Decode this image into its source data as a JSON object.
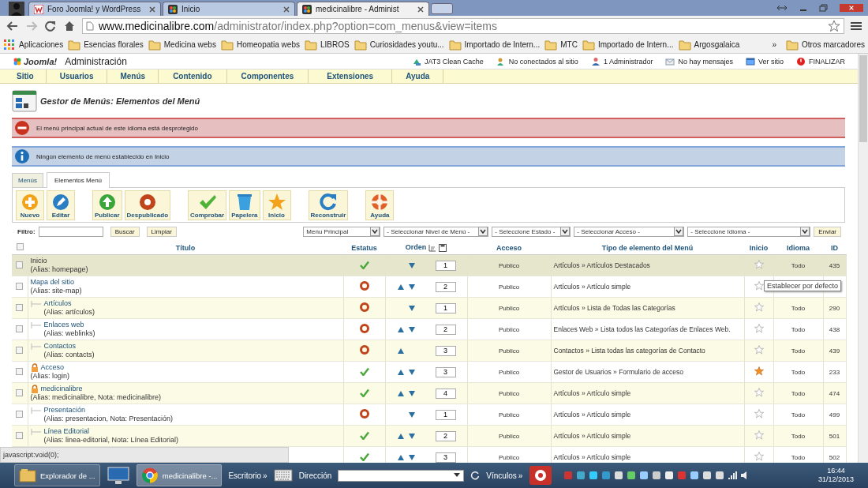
{
  "browser": {
    "tabs": [
      {
        "title": "Foro Joomla! y WordPress",
        "kind": "forum",
        "selected": false
      },
      {
        "title": "Inicio",
        "kind": "joomla",
        "selected": false
      },
      {
        "title": "medicinalibre - Administ",
        "kind": "joomla",
        "selected": true
      }
    ],
    "url_host": "www.medicinalibre.com",
    "url_path": "/administrator/index.php?option=com_menus&view=items",
    "bookmarks": [
      {
        "label": "Aplicaciones",
        "kind": "apps"
      },
      {
        "label": "Esencias florales",
        "kind": "folder"
      },
      {
        "label": "Medicina webs",
        "kind": "folder"
      },
      {
        "label": "Homeopatia webs",
        "kind": "folder"
      },
      {
        "label": "LIBROS",
        "kind": "folder"
      },
      {
        "label": "Curiosidades youtu...",
        "kind": "folder"
      },
      {
        "label": "Importado de Intern...",
        "kind": "folder"
      },
      {
        "label": "MTC",
        "kind": "folder"
      },
      {
        "label": "Importado de Intern...",
        "kind": "folder"
      },
      {
        "label": "Argosgalaica",
        "kind": "folder"
      }
    ],
    "bookmarks_more": "»",
    "other_bookmarks": "Otros marcadores"
  },
  "admin_header": {
    "logo": "Joomla!",
    "title": "Administración",
    "status_items": [
      {
        "label": "JAT3 Clean Cache",
        "kind": "cache"
      },
      {
        "label": "No conectados al sitio",
        "kind": "users"
      },
      {
        "label": "1 Administrador",
        "kind": "admin"
      },
      {
        "label": "No hay mensajes",
        "kind": "messages"
      },
      {
        "label": "Ver sitio",
        "kind": "site"
      },
      {
        "label": "FINALIZAR",
        "kind": "logout"
      }
    ]
  },
  "menu_bar": [
    "Sitio",
    "Usuarios",
    "Menús",
    "Contenido",
    "Componentes",
    "Extensiones",
    "Ayuda"
  ],
  "page_title": "Gestor de Menús: Elementos del Menú",
  "messages": [
    {
      "kind": "error",
      "text": "El menú principal actual de este idioma está desprotegido"
    },
    {
      "kind": "info",
      "text": "Ningún elemento de menú establecido en Inicio"
    }
  ],
  "tabs": [
    {
      "label": "Menús",
      "selected": false
    },
    {
      "label": "Elementos Menú",
      "selected": true
    }
  ],
  "toolbar": [
    [
      {
        "label": "Nuevo",
        "kind": "new"
      },
      {
        "label": "Editar",
        "kind": "edit"
      }
    ],
    [
      {
        "label": "Publicar",
        "kind": "publish"
      },
      {
        "label": "Despublicado",
        "kind": "unpublish"
      }
    ],
    [
      {
        "label": "Comprobar",
        "kind": "checkin"
      },
      {
        "label": "Papelera",
        "kind": "trash"
      },
      {
        "label": "Inicio",
        "kind": "home"
      }
    ],
    [
      {
        "label": "Reconstruir",
        "kind": "rebuild"
      }
    ],
    [
      {
        "label": "Ayuda",
        "kind": "help"
      }
    ]
  ],
  "filter": {
    "label": "Filtro:",
    "buttons": [
      "Buscar",
      "Limpiar"
    ],
    "selects": [
      "Menu Principal",
      "- Seleccionar Nivel de Menú -",
      "- Seleccione Estado -",
      "- Seleccionar Acceso -",
      "- Seleccione Idioma -"
    ],
    "submit": "Enviar"
  },
  "table": {
    "select_all_checked": false,
    "columns": [
      "Título",
      "Estatus",
      "Orden",
      "Acceso",
      "Tipo de elemento del Menú",
      "Inicio",
      "Idioma",
      "ID"
    ],
    "rows": [
      {
        "checked": false,
        "title": "Inicio",
        "alias": "(Alias: homepage)",
        "locked": false,
        "hovered": true,
        "published": true,
        "up": false,
        "down": true,
        "order": "1",
        "access": "Publico",
        "type": "Artículos » Artículos Destacados",
        "home": false,
        "language": "Todo",
        "id": "435"
      },
      {
        "checked": false,
        "title": "Mapa del sitio",
        "alias": "(Alias: site-map)",
        "locked": false,
        "hovered": false,
        "published": false,
        "up": true,
        "down": true,
        "order": "2",
        "access": "Publico",
        "type": "Artículos » Artículo simple",
        "home": false,
        "children": [
          {
            "checked": false,
            "title": "Artículos",
            "alias": "(Alias: artículos)",
            "locked": false,
            "hovered": false,
            "published": false,
            "up": false,
            "down": true,
            "order": "1",
            "access": "Publico",
            "type": "Artículos » Lista de Todas las Categorías",
            "home": false,
            "language": "Todo",
            "id": "290"
          },
          {
            "checked": false,
            "title": "Enlaces web",
            "alias": "(Alias: weblinks)",
            "locked": false,
            "hovered": false,
            "published": false,
            "up": true,
            "down": true,
            "order": "2",
            "access": "Publico",
            "type": "Enlaces Web » Lista todos las Categorías de Enlaces Web.",
            "home": false,
            "language": "Todo",
            "id": "438"
          },
          {
            "checked": false,
            "title": "Contactos",
            "alias": "(Alias: contacts)",
            "locked": false,
            "hovered": false,
            "published": false,
            "up": true,
            "down": false,
            "order": "3",
            "access": "Publico",
            "type": "Contactos » Lista todas las categorías de Contacto",
            "home": false,
            "language": "Todo",
            "id": "439"
          }
        ]
      },
      {
        "checked": false,
        "title": "Acceso",
        "alias": "(Alias: login)",
        "locked": true,
        "hovered": false,
        "published": true,
        "up": true,
        "down": true,
        "order": "3",
        "access": "Publico",
        "type": "Gestor de Usuarios » Formulario de acceso",
        "home": true,
        "language": "Todo",
        "id": "233"
      },
      {
        "checked": false,
        "title": "medicinalibre",
        "alias": "(Alias: medicinalibre, Nota: medicinalibre)",
        "locked": true,
        "hovered": false,
        "published": true,
        "up": true,
        "down": true,
        "order": "4",
        "access": "Publico",
        "type": "Artículos » Artículo simple",
        "home": false,
        "language": "Todo",
        "id": "474",
        "children": [
          {
            "checked": false,
            "title": "Presentación",
            "alias": "(Alias: presentacion, Nota: Presentación)",
            "locked": false,
            "hovered": false,
            "published": false,
            "up": false,
            "down": true,
            "order": "1",
            "access": "Publico",
            "type": "Artículos » Artículo simple",
            "home": false,
            "language": "Todo",
            "id": "499"
          },
          {
            "checked": false,
            "title": "Línea Editorial",
            "alias": "(Alias: linea-editorial, Nota: Línea Editorial)",
            "locked": false,
            "hovered": false,
            "published": true,
            "up": true,
            "down": true,
            "order": "2",
            "access": "Publico",
            "type": "Artículos » Artículo simple",
            "home": false,
            "language": "Todo",
            "id": "501"
          },
          {
            "hovered": false,
            "published": true,
            "up": true,
            "down": true,
            "order": "3",
            "access": "Publico",
            "type": "Artículos » Artículo simple",
            "home": false,
            "language": "Todo",
            "id": "502"
          }
        ]
      }
    ]
  },
  "tooltip": "Establecer por defecto",
  "status_bubble": "javascript:void(0);",
  "taskbar": {
    "buttons": [
      {
        "label": "Explorador de ...",
        "kind": "explorer",
        "selected": false
      },
      {
        "label": "medicinalibre -...",
        "kind": "chrome",
        "selected": true
      }
    ],
    "toolbars": [
      "Escritorio",
      "Dirección",
      "Vínculos"
    ],
    "more": "»",
    "time": "16:44",
    "date": "31/12/2013"
  }
}
